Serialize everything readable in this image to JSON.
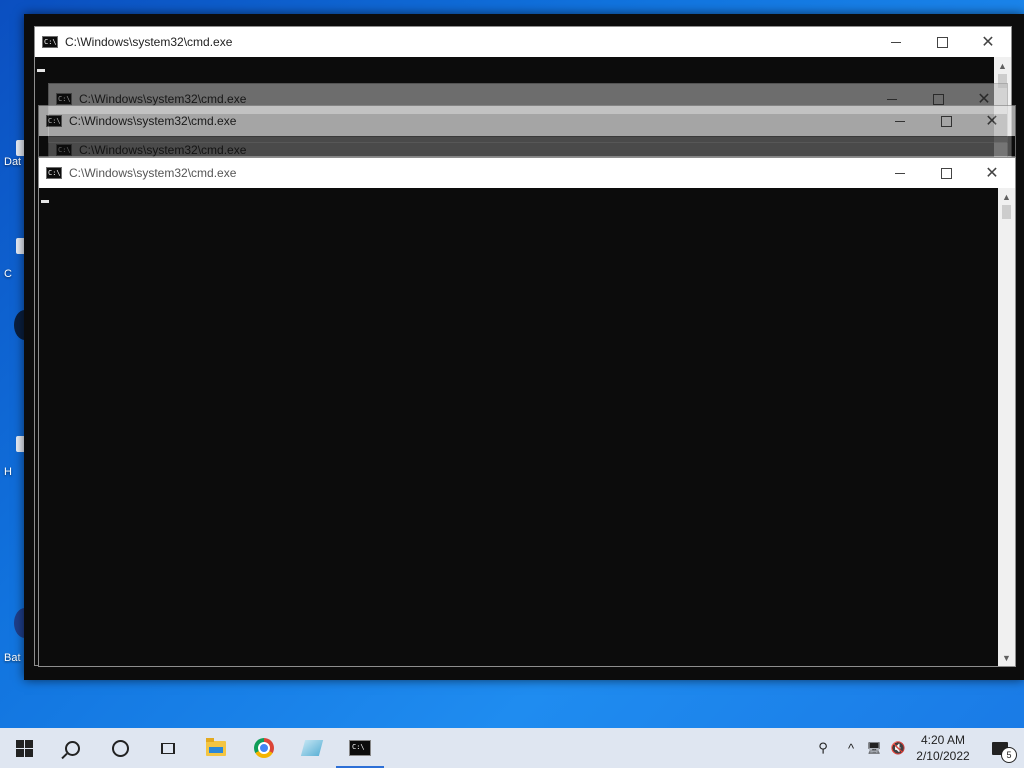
{
  "desktop": {
    "icons": [
      {
        "label": "Dat"
      },
      {
        "label": "C"
      },
      {
        "label": "H"
      },
      {
        "label": "Bat"
      }
    ]
  },
  "windows": {
    "title": "C:\\Windows\\system32\\cmd.exe",
    "cmd_icon_text": "C:\\",
    "close_glyph": "✕",
    "scroll_up": "▲",
    "scroll_down": "▼"
  },
  "taskbar": {
    "apps": [
      {
        "name": "start"
      },
      {
        "name": "search"
      },
      {
        "name": "cortana"
      },
      {
        "name": "task-view"
      },
      {
        "name": "file-explorer"
      },
      {
        "name": "chrome"
      },
      {
        "name": "notepad"
      },
      {
        "name": "command-prompt"
      }
    ],
    "tray": {
      "people_glyph": "⚲",
      "chevron": "^",
      "network_glyph": "🖥",
      "volume_glyph": "🔇"
    },
    "clock": {
      "time": "4:20 AM",
      "date": "2/10/2022"
    },
    "notifications_count": "5"
  }
}
